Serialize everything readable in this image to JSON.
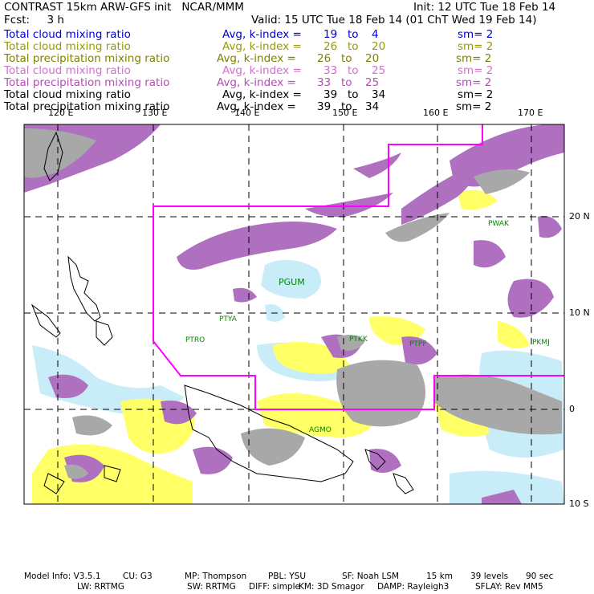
{
  "header": {
    "title": "CONTRAST 15km ARW-GFS init   NCAR/MMM",
    "init": "Init: 12 UTC Tue 18 Feb 14",
    "fcst": "Fcst:     3 h",
    "valid": "Valid: 15 UTC Tue 18 Feb 14 (01 ChT Wed 19 Feb 14)"
  },
  "legend": [
    {
      "field": "Total cloud mixing ratio",
      "avg": "Avg, k-index =",
      "k1": "19",
      "to": "to",
      "k2": "4",
      "sm": "sm= 2",
      "color": "#0000cc"
    },
    {
      "field": "Total cloud mixing ratio",
      "avg": "Avg, k-index =",
      "k1": "26",
      "to": "to",
      "k2": "20",
      "sm": "sm= 2",
      "color": "#999900"
    },
    {
      "field": "Total precipitation mixing ratio",
      "avg": "Avg, k-index =",
      "k1": "26",
      "to": "to",
      "k2": "20",
      "sm": "sm= 2",
      "color": "#808000"
    },
    {
      "field": "Total cloud mixing ratio",
      "avg": "Avg, k-index =",
      "k1": "33",
      "to": "to",
      "k2": "25",
      "sm": "sm= 2",
      "color": "#d070d0"
    },
    {
      "field": "Total precipitation mixing ratio",
      "avg": "Avg, k-index =",
      "k1": "33",
      "to": "to",
      "k2": "25",
      "sm": "sm= 2",
      "color": "#b050b0"
    },
    {
      "field": "Total cloud mixing ratio",
      "avg": "Avg, k-index =",
      "k1": "39",
      "to": "to",
      "k2": "34",
      "sm": "sm= 2",
      "color": "#000000"
    },
    {
      "field": "Total precipitation mixing ratio",
      "avg": "Avg, k-index =",
      "k1": "39",
      "to": "to",
      "k2": "34",
      "sm": "sm= 2",
      "color": "#000000"
    }
  ],
  "map": {
    "lon_labels": [
      "120 E",
      "130 E",
      "140 E",
      "150 E",
      "160 E",
      "170 E"
    ],
    "lat_labels": [
      "20 N",
      "10 N",
      "0",
      "10 S"
    ],
    "stations": [
      {
        "code": "PWAK"
      },
      {
        "code": "PGUM"
      },
      {
        "code": "PTYA"
      },
      {
        "code": "PTRO"
      },
      {
        "code": "PTKK"
      },
      {
        "code": "PTPF"
      },
      {
        "code": "PKMJ"
      },
      {
        "code": "AGMO"
      }
    ],
    "colors": {
      "land": "#000000",
      "grid": "#000000",
      "domain": "#ff00ff",
      "cloud_high": "#b070c0",
      "cloud_mid": "#ffff66",
      "cloud_low": "#c8ecf8",
      "gray": "#a8a8a8",
      "station_text": "#008800"
    }
  },
  "footer": {
    "line1": [
      "Model Info: V3.5.1",
      "CU: G3",
      "MP: Thompson",
      "PBL: YSU",
      "SF: Noah LSM",
      "15 km",
      "39 levels",
      "90 sec"
    ],
    "line2": [
      "LW: RRTMG",
      "SW: RRTMG",
      "DIFF: simple",
      "KM: 3D Smagor",
      "DAMP: Rayleigh3",
      "SFLAY: Rev MM5"
    ]
  }
}
